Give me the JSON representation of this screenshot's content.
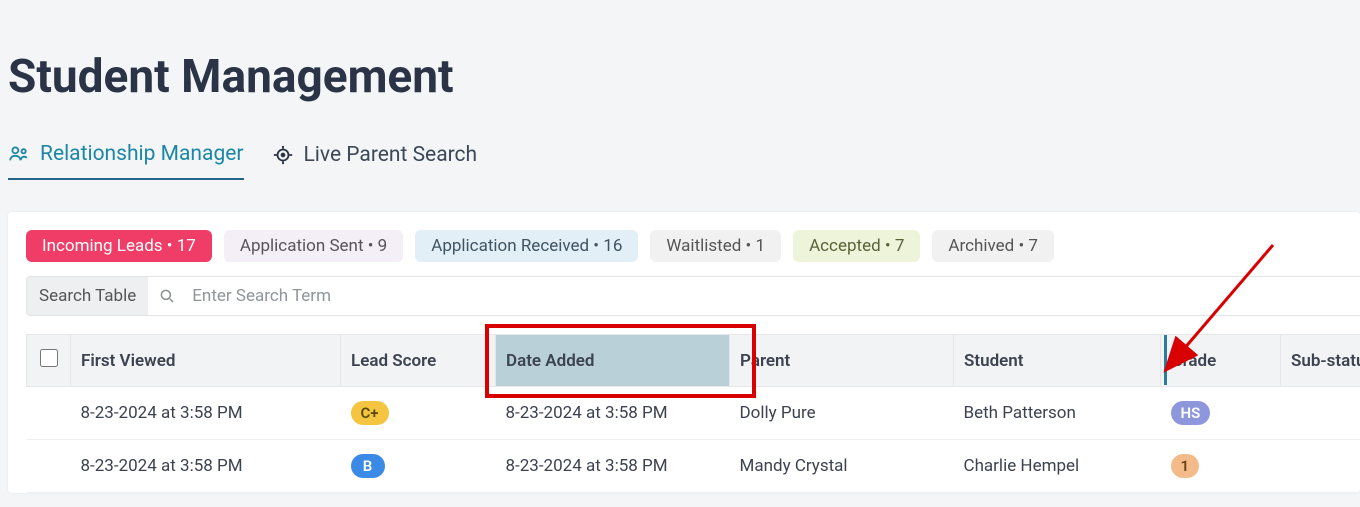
{
  "page": {
    "title": "Student Management"
  },
  "tabs": {
    "relationship": "Relationship Manager",
    "live_parent": "Live Parent Search"
  },
  "filters": {
    "incoming": "Incoming Leads • 17",
    "app_sent": "Application Sent • 9",
    "app_recv": "Application Received • 16",
    "waitlisted": "Waitlisted • 1",
    "accepted": "Accepted • 7",
    "archived": "Archived • 7"
  },
  "search": {
    "label": "Search Table",
    "placeholder": "Enter Search Term"
  },
  "columns": {
    "first_viewed": "First Viewed",
    "lead_score": "Lead Score",
    "date_added": "Date Added",
    "parent": "Parent",
    "student": "Student",
    "grade": "Grade",
    "sub_status": "Sub-status"
  },
  "rows": [
    {
      "first_viewed": "8-23-2024 at 3:58 PM",
      "lead_score": "C+",
      "lead_score_class": "score-cplus",
      "date_added": "8-23-2024 at 3:58 PM",
      "parent": "Dolly Pure",
      "student": "Beth Patterson",
      "grade": "HS",
      "grade_class": "grade-hs"
    },
    {
      "first_viewed": "8-23-2024 at 3:58 PM",
      "lead_score": "B",
      "lead_score_class": "score-b",
      "date_added": "8-23-2024 at 3:58 PM",
      "parent": "Mandy Crystal",
      "student": "Charlie Hempel",
      "grade": "1",
      "grade_class": "grade-1"
    }
  ]
}
